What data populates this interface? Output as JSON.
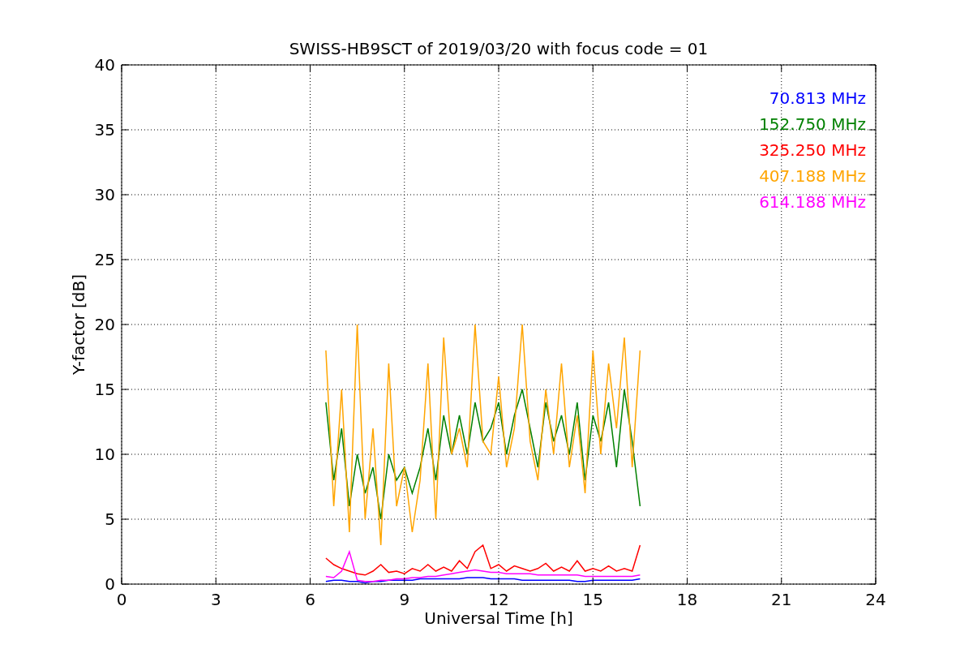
{
  "chart_data": {
    "type": "line",
    "title": "SWISS-HB9SCT of 2019/03/20 with focus code = 01",
    "xlabel": "Universal Time [h]",
    "ylabel": "Y-factor [dB]",
    "x": [
      6.5,
      6.75,
      7,
      7.25,
      7.5,
      7.75,
      8,
      8.25,
      8.5,
      8.75,
      9,
      9.25,
      9.5,
      9.75,
      10,
      10.25,
      10.5,
      10.75,
      11,
      11.25,
      11.5,
      11.75,
      12,
      12.25,
      12.5,
      12.75,
      13,
      13.25,
      13.5,
      13.75,
      14,
      14.25,
      14.5,
      14.75,
      15,
      15.25,
      15.5,
      15.75,
      16,
      16.25,
      16.5
    ],
    "series": [
      {
        "name": "70.813 MHz",
        "color": "#0000ff",
        "values": [
          0.2,
          0.3,
          0.3,
          0.2,
          0.2,
          0.1,
          0.2,
          0.2,
          0.3,
          0.3,
          0.3,
          0.3,
          0.4,
          0.4,
          0.4,
          0.4,
          0.4,
          0.4,
          0.5,
          0.5,
          0.5,
          0.4,
          0.4,
          0.4,
          0.4,
          0.3,
          0.3,
          0.3,
          0.3,
          0.3,
          0.3,
          0.3,
          0.2,
          0.2,
          0.3,
          0.3,
          0.3,
          0.3,
          0.3,
          0.3,
          0.4
        ]
      },
      {
        "name": "152.750 MHz",
        "color": "#008000",
        "values": [
          14,
          8,
          12,
          6,
          10,
          7,
          9,
          5,
          10,
          8,
          9,
          7,
          9,
          12,
          8,
          13,
          10,
          13,
          10,
          14,
          11,
          12,
          14,
          10,
          13,
          15,
          12,
          9,
          14,
          11,
          13,
          10,
          14,
          8,
          13,
          11,
          14,
          9,
          15,
          11,
          6
        ]
      },
      {
        "name": "325.250 MHz",
        "color": "#ff0000",
        "values": [
          2,
          1.5,
          1.2,
          1,
          0.8,
          0.7,
          1,
          1.5,
          0.9,
          1,
          0.8,
          1.2,
          1,
          1.5,
          1,
          1.3,
          1,
          1.8,
          1.2,
          2.5,
          3,
          1.2,
          1.5,
          1,
          1.4,
          1.2,
          1,
          1.2,
          1.6,
          1,
          1.3,
          1,
          1.8,
          1,
          1.2,
          1,
          1.4,
          1,
          1.2,
          1,
          3
        ]
      },
      {
        "name": "407.188 MHz",
        "color": "#ffa500",
        "values": [
          18,
          6,
          15,
          4,
          20,
          5,
          12,
          3,
          17,
          6,
          9,
          4,
          8,
          17,
          5,
          19,
          10,
          12,
          9,
          20,
          11,
          10,
          16,
          9,
          12,
          20,
          11,
          8,
          15,
          10,
          17,
          9,
          13,
          7,
          18,
          10,
          17,
          12,
          19,
          9,
          18
        ]
      },
      {
        "name": "614.188 MHz",
        "color": "#ff00ff",
        "values": [
          0.6,
          0.5,
          1,
          2.5,
          0.3,
          0.2,
          0.2,
          0.3,
          0.3,
          0.4,
          0.4,
          0.5,
          0.5,
          0.6,
          0.6,
          0.7,
          0.8,
          0.9,
          1,
          1.1,
          1,
          0.9,
          0.9,
          0.8,
          0.8,
          0.8,
          0.8,
          0.7,
          0.7,
          0.7,
          0.7,
          0.7,
          0.7,
          0.6,
          0.6,
          0.6,
          0.6,
          0.6,
          0.6,
          0.6,
          0.7
        ]
      }
    ],
    "grid": true,
    "xlim": [
      0,
      24
    ],
    "ylim": [
      0,
      40
    ],
    "xticks": [
      0,
      3,
      6,
      9,
      12,
      15,
      18,
      21,
      24
    ],
    "yticks": [
      0,
      5,
      10,
      15,
      20,
      25,
      30,
      35,
      40
    ]
  }
}
